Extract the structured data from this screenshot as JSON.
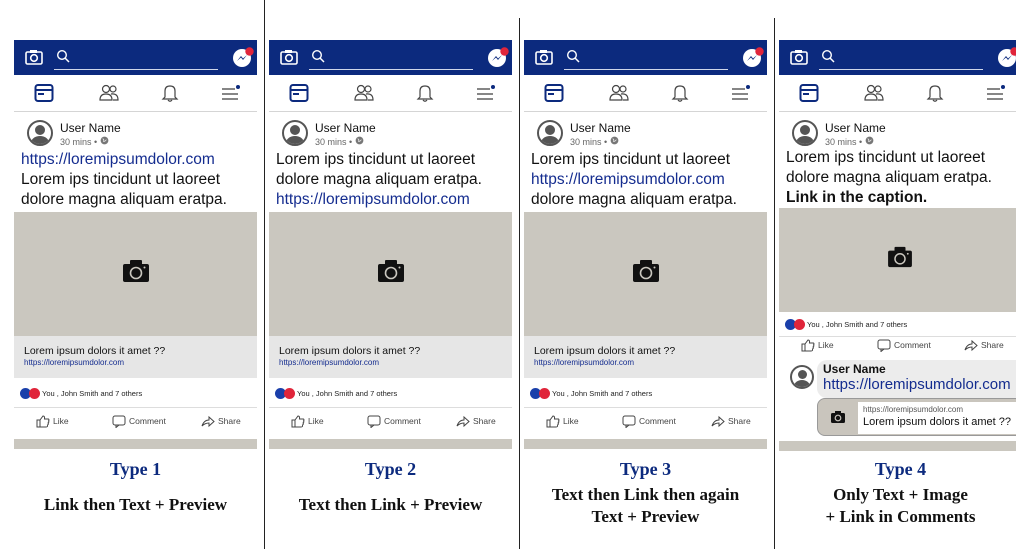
{
  "colors": {
    "header_blue": "#0c2a7e",
    "link_blue": "#142c8f",
    "image_gray": "#cac7bf",
    "notification_red": "#e0253a"
  },
  "icons": {
    "topbar": [
      "camera-icon",
      "search-icon",
      "messenger-icon"
    ],
    "navbar": [
      "news-feed-icon",
      "friends-icon",
      "notifications-icon",
      "menu-icon"
    ],
    "actions": [
      "like-icon",
      "comment-icon",
      "share-icon"
    ]
  },
  "post": {
    "user_name": "User Name",
    "time": "30 mins",
    "dot": "•",
    "reactions_text": "You , John Smith and 7 others",
    "like": "Like",
    "comment": "Comment",
    "share": "Share",
    "preview_title": "Lorem ipsum dolors it amet ??",
    "preview_url": "https://loremipsumdolor.com"
  },
  "panels": [
    {
      "type_label": "Type 1",
      "desc_lines": [
        "Link then Text + Preview"
      ],
      "text_lines": [
        {
          "text": "https://loremipsumdolor.com",
          "style": "link"
        },
        {
          "text": "Lorem ips tincidunt ut laoreet",
          "style": "plain"
        },
        {
          "text": "dolore magna aliquam eratpa.",
          "style": "plain"
        }
      ]
    },
    {
      "type_label": "Type 2",
      "desc_lines": [
        "Text then Link + Preview"
      ],
      "text_lines": [
        {
          "text": "Lorem ips tincidunt ut laoreet",
          "style": "plain"
        },
        {
          "text": "dolore magna aliquam eratpa.",
          "style": "plain"
        },
        {
          "text": "https://loremipsumdolor.com",
          "style": "link"
        }
      ]
    },
    {
      "type_label": "Type 3",
      "desc_lines": [
        "Text then Link then again",
        "Text + Preview"
      ],
      "text_lines": [
        {
          "text": "Lorem ips tincidunt ut laoreet",
          "style": "plain"
        },
        {
          "text": "https://loremipsumdolor.com",
          "style": "link"
        },
        {
          "text": "dolore magna aliquam eratpa.",
          "style": "plain"
        }
      ]
    },
    {
      "type_label": "Type 4",
      "desc_lines": [
        "Only Text + Image",
        "+ Link in Comments"
      ],
      "text_lines": [
        {
          "text": "Lorem ips tincidunt ut laoreet",
          "style": "plain"
        },
        {
          "text": "dolore magna aliquam eratpa.",
          "style": "plain"
        },
        {
          "text": "Link in the caption.",
          "style": "bold"
        }
      ],
      "comment": {
        "user_name": "User Name",
        "link": "https://loremipsumdolor.com",
        "card_url": "https://loremipsumdolor.com",
        "card_title": "Lorem ipsum dolors it amet ??"
      }
    }
  ]
}
